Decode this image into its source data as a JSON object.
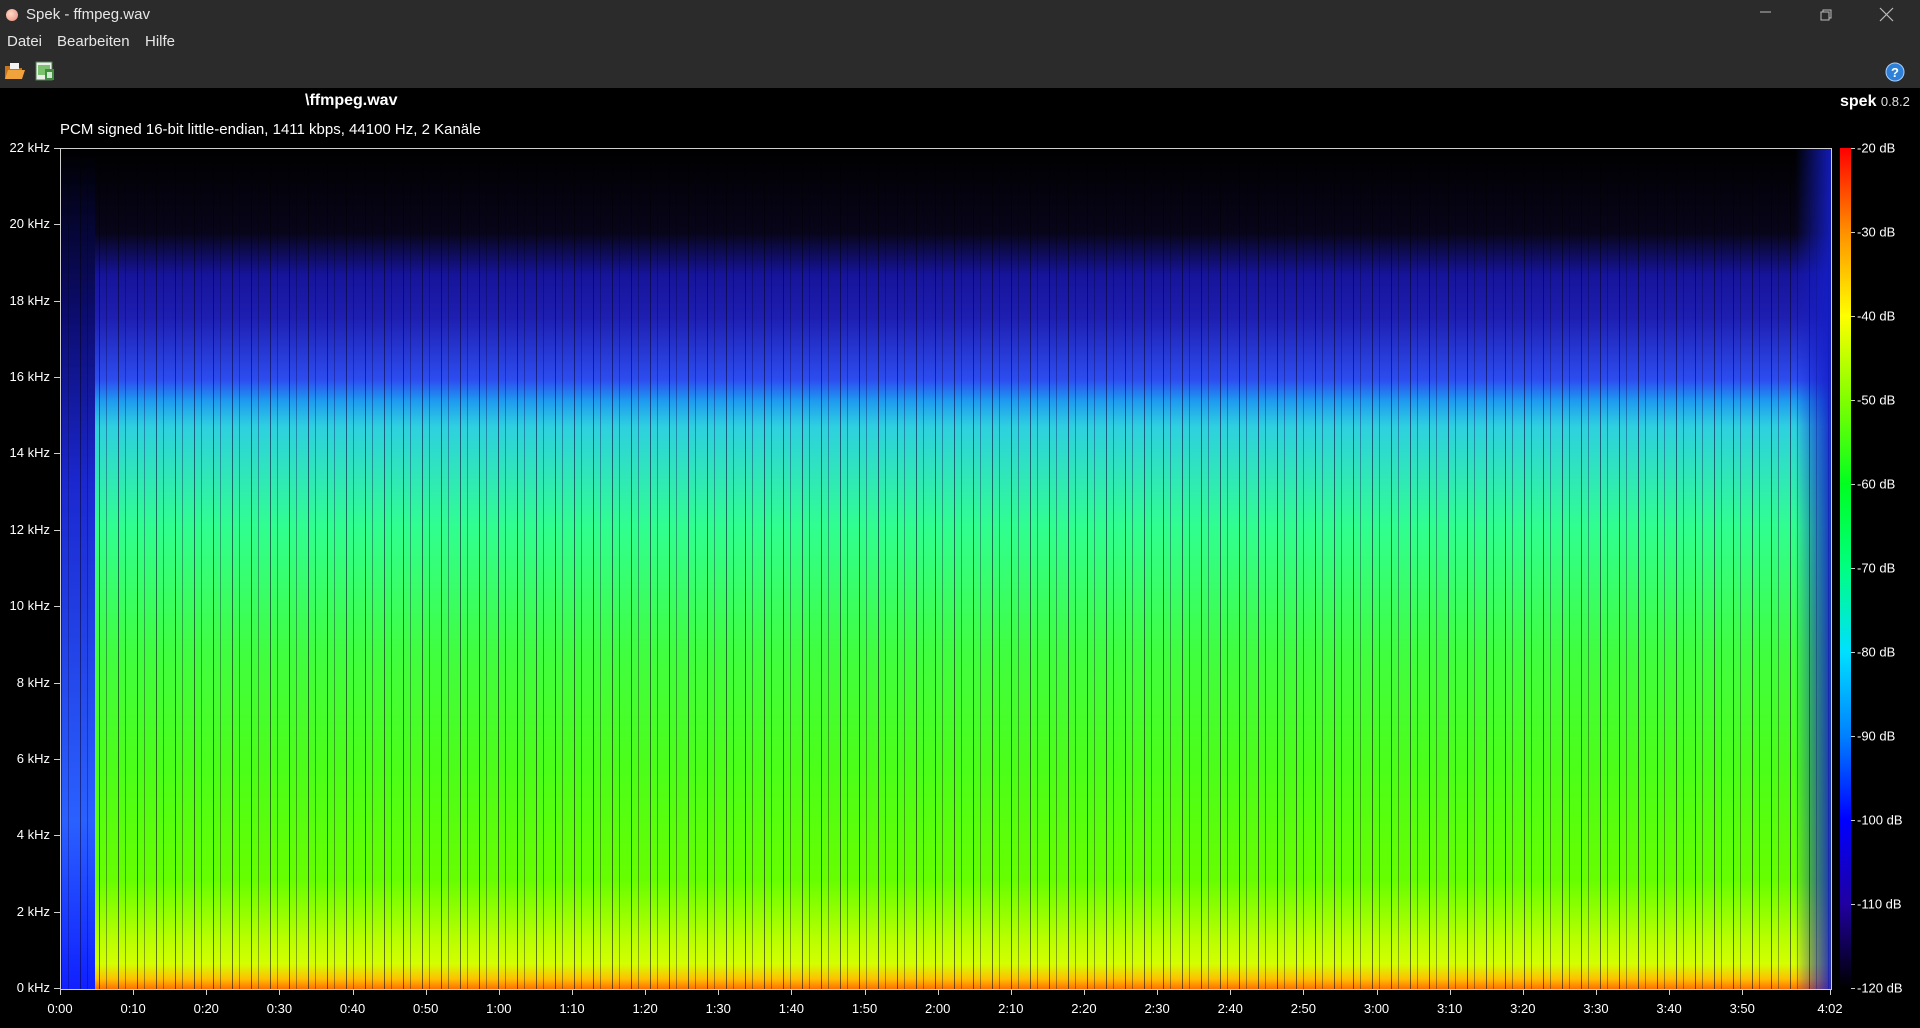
{
  "window": {
    "title": "Spek - ffmpeg.wav",
    "controls": [
      "minimize",
      "restore",
      "close"
    ]
  },
  "menu": {
    "items": [
      "Datei",
      "Bearbeiten",
      "Hilfe"
    ]
  },
  "toolbar": {
    "open_icon": "folder-open-icon",
    "save_icon": "save-image-icon",
    "help_icon": "help-icon"
  },
  "header": {
    "file_name": "\\ffmpeg.wav",
    "brand_name": "spek",
    "brand_version": "0.8.2",
    "stream_info": "PCM signed 16-bit little-endian, 1411 kbps, 44100 Hz, 2 Kanäle"
  },
  "chart_data": {
    "type": "heatmap",
    "x_axis": {
      "range_seconds": [
        0,
        242
      ],
      "ticks": [
        "0:00",
        "0:10",
        "0:20",
        "0:30",
        "0:40",
        "0:50",
        "1:00",
        "1:10",
        "1:20",
        "1:30",
        "1:40",
        "1:50",
        "2:00",
        "2:10",
        "2:20",
        "2:30",
        "2:40",
        "2:50",
        "3:00",
        "3:10",
        "3:20",
        "3:30",
        "3:40",
        "3:50",
        "4:02"
      ]
    },
    "y_axis": {
      "range_khz": [
        0,
        22
      ],
      "ticks": [
        "22 kHz",
        "20 kHz",
        "18 kHz",
        "16 kHz",
        "14 kHz",
        "12 kHz",
        "10 kHz",
        "8 kHz",
        "6 kHz",
        "4 kHz",
        "2 kHz",
        "0 kHz"
      ]
    },
    "color_scale": {
      "range_db": [
        -120,
        -20
      ],
      "ticks": [
        "-20 dB",
        "-30 dB",
        "-40 dB",
        "-50 dB",
        "-60 dB",
        "-70 dB",
        "-80 dB",
        "-90 dB",
        "-100 dB",
        "-110 dB",
        "-120 dB"
      ],
      "colors": [
        "#ff0000",
        "#ff9000",
        "#ffff00",
        "#00ff20",
        "#00e0ff",
        "#0000ff",
        "#000000"
      ]
    }
  }
}
